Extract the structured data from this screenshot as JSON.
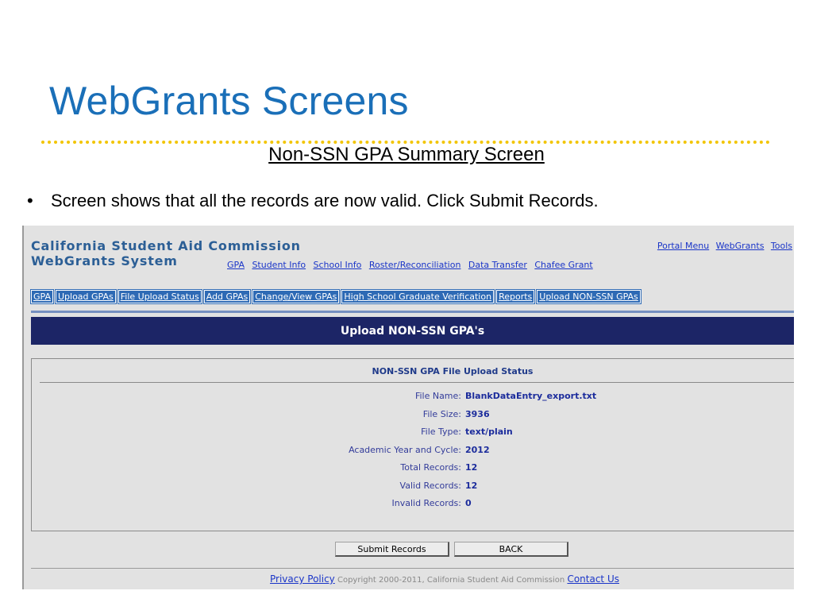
{
  "slide": {
    "title": "WebGrants Screens",
    "subtitle": "Non-SSN GPA Summary Screen",
    "bullet_marker": "•",
    "bullet": "Screen shows that all the records are now valid. Click Submit Records."
  },
  "app": {
    "org_name": "California Student Aid Commission",
    "system_name": "WebGrants System",
    "top_links": [
      "Portal Menu",
      "WebGrants",
      "Tools"
    ],
    "main_nav": [
      "GPA",
      "Student Info",
      "School Info",
      "Roster/Reconciliation",
      "Data Transfer",
      "Chafee Grant"
    ],
    "sub_nav": [
      "GPA",
      "Upload GPAs",
      "File Upload Status",
      "Add GPAs",
      "Change/View GPAs",
      "High School Graduate Verification",
      "Reports",
      "Upload NON-SSN GPAs"
    ],
    "banner": "Upload NON-SSN GPA's",
    "panel_title": "NON-SSN GPA File Upload Status",
    "fields": [
      {
        "label": "File Name:",
        "value": "BlankDataEntry_export.txt"
      },
      {
        "label": "File Size:",
        "value": "3936"
      },
      {
        "label": "File Type:",
        "value": "text/plain"
      },
      {
        "label": "Academic Year and Cycle:",
        "value": "2012"
      },
      {
        "label": "Total Records:",
        "value": "12"
      },
      {
        "label": "Valid Records:",
        "value": "12"
      },
      {
        "label": "Invalid Records:",
        "value": "0"
      }
    ],
    "buttons": {
      "submit": "Submit Records",
      "back": "BACK"
    },
    "footer": {
      "privacy": "Privacy Policy",
      "copyright": "Copyright 2000-2011, California Student Aid Commission",
      "contact": "Contact Us"
    }
  },
  "colors": {
    "slide_title": "#1a6fb8",
    "dotted_rule": "#f2c500",
    "org_text": "#2c5f96",
    "banner_bg": "#1c2566",
    "subnav_bg": "#2e6ab5",
    "link": "#1a35c8"
  }
}
